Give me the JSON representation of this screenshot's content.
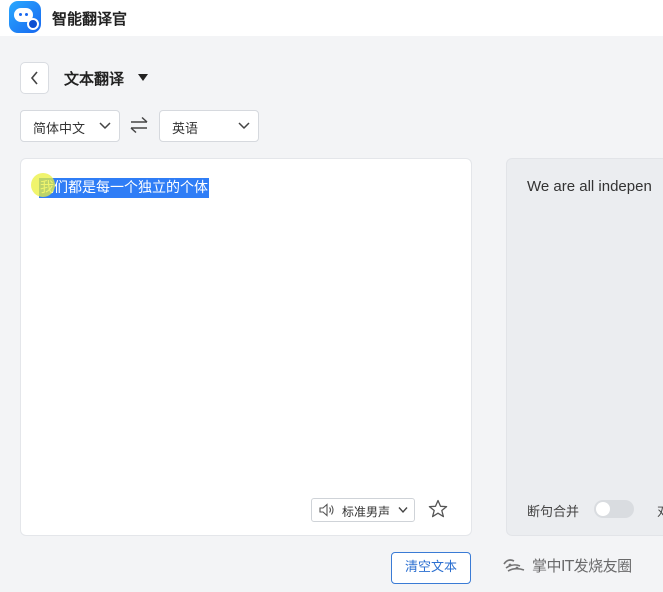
{
  "app": {
    "title": "智能翻译官"
  },
  "header": {
    "mode_title": "文本翻译"
  },
  "languages": {
    "source": "简体中文",
    "target": "英语"
  },
  "source_panel": {
    "text": "我们都是每一个独立的个体",
    "voice": "标准男声"
  },
  "target_panel": {
    "text": "We are all indepen",
    "merge_label": "断句合并",
    "merge_enabled": false,
    "next_label": "对"
  },
  "actions": {
    "clear_label": "清空文本"
  },
  "watermark": {
    "text": "掌中IT发烧友圈"
  },
  "colors": {
    "accent": "#2b6fd0",
    "selection": "#2f7df6",
    "background": "#f3f4f6"
  }
}
